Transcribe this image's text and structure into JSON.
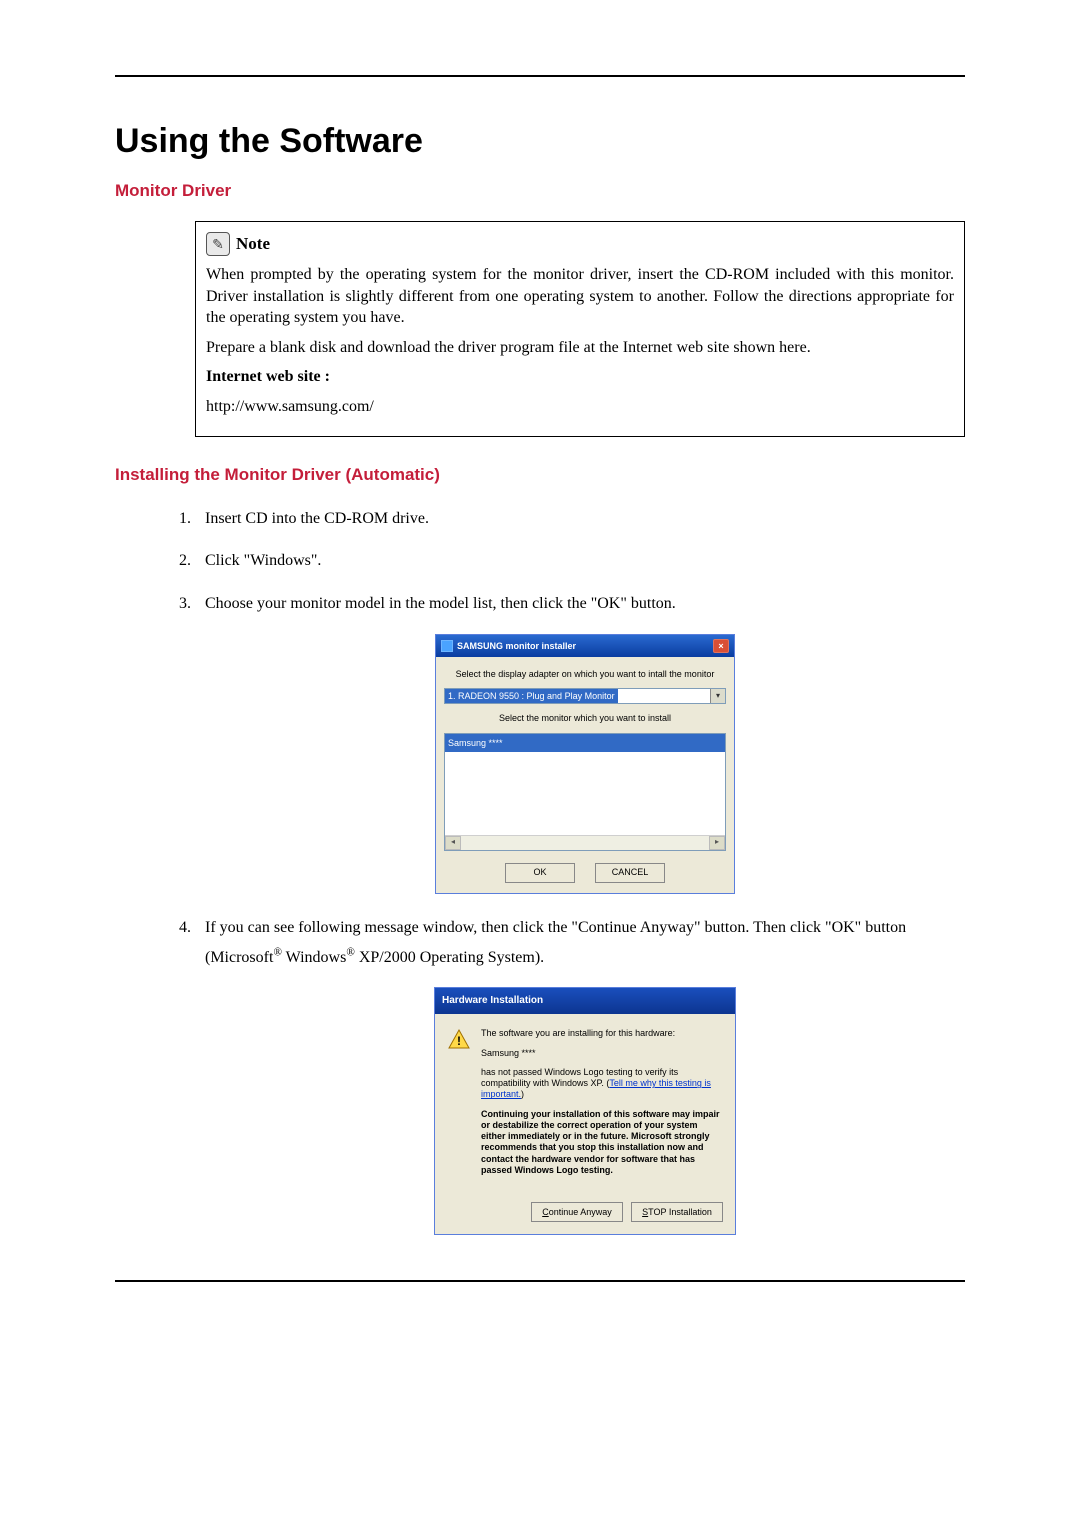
{
  "page": {
    "title": "Using the Software",
    "section1_heading": "Monitor Driver",
    "section2_heading": "Installing the Monitor Driver (Automatic)"
  },
  "note": {
    "label": "Note",
    "para1": "When prompted by the operating system for the monitor driver, insert the CD-ROM included with this monitor. Driver installation is slightly different from one operating system to another. Follow the directions appropriate for the operating system you have.",
    "para2": "Prepare a blank disk and download the driver program file at the Internet web site shown here.",
    "bold_label": "Internet web site :",
    "url": "http://www.samsung.com/"
  },
  "steps": {
    "s1": "Insert CD into the CD-ROM drive.",
    "s2": "Click \"Windows\".",
    "s3": "Choose your monitor model in the model list, then click the \"OK\" button.",
    "s4_part1": "If you can see following message window, then click the \"Continue Anyway\" button. Then click \"OK\" button (Microsoft",
    "s4_reg1": "®",
    "s4_part2": " Windows",
    "s4_reg2": "®",
    "s4_part3": " XP/2000 Operating System)."
  },
  "dialog1": {
    "title": "SAMSUNG monitor installer",
    "line1": "Select the display adapter on which you want to intall the monitor",
    "select_value": "1. RADEON 9550 : Plug and Play Monitor",
    "line2": "Select the monitor which you want to install",
    "list_item": "Samsung ****",
    "btn_ok": "OK",
    "btn_cancel": "CANCEL"
  },
  "dialog2": {
    "title": "Hardware Installation",
    "line1": "The software you are installing for this hardware:",
    "device": "Samsung ****",
    "line2_a": "has not passed Windows Logo testing to verify its compatibility with Windows XP. (",
    "link_text": "Tell me why this testing is important.",
    "line2_b": ")",
    "warn_bold": "Continuing your installation of this software may impair or destabilize the correct operation of your system either immediately or in the future. Microsoft strongly recommends that you stop this installation now and contact the hardware vendor for software that has passed Windows Logo testing.",
    "btn_continue": "Continue Anyway",
    "btn_stop": "STOP Installation"
  }
}
